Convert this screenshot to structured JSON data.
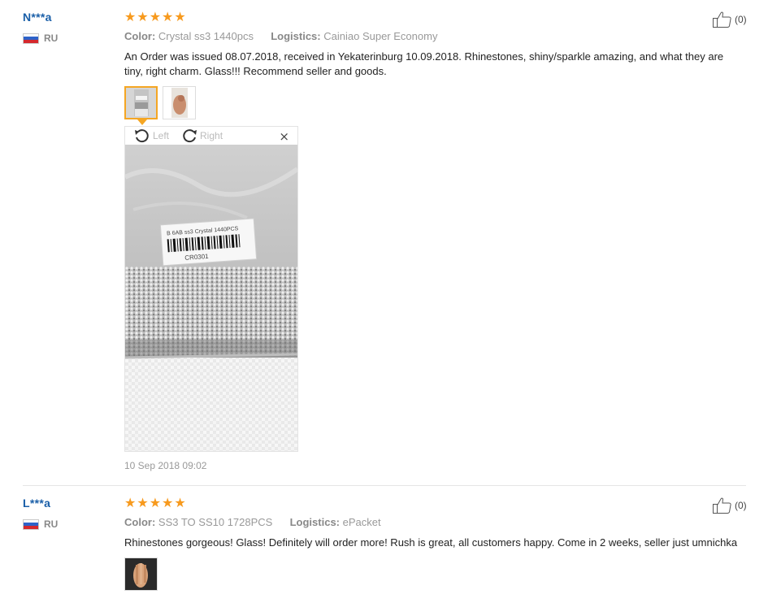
{
  "reviews": [
    {
      "user": "N***a",
      "country": "RU",
      "rating": 5,
      "color_label": "Color:",
      "color_value": "Crystal ss3 1440pcs",
      "logistics_label": "Logistics:",
      "logistics_value": "Cainiao Super Economy",
      "text": "An Order was issued 08.07.2018, received in Yekaterinburg 10.09.2018. Rhinestones, shiny/sparkle amazing, and what they are tiny, right charm. Glass!!! Recommend seller and goods.",
      "helpful": "(0)",
      "viewer": {
        "rotate_left": "Left",
        "rotate_right": "Right",
        "close": "×",
        "label_line1": "B 6AB    ss3 Crystal 1440PCS",
        "label_code": "CR0301"
      },
      "date": "10 Sep 2018 09:02"
    },
    {
      "user": "L***a",
      "country": "RU",
      "rating": 5,
      "color_label": "Color:",
      "color_value": "SS3 TO SS10 1728PCS",
      "logistics_label": "Logistics:",
      "logistics_value": "ePacket",
      "text": "Rhinestones gorgeous! Glass! Definitely will order more! Rush is great, all customers happy. Come in 2 weeks, seller just umnichka",
      "helpful": "(0)"
    }
  ],
  "star_char": "★",
  "colors": {
    "username": "#1a5fa8",
    "star": "#f79a1e",
    "selected_thumb": "#f5a623"
  },
  "icons": {
    "helpful": "thumbs-up-icon",
    "rotate_left": "rotate-left-icon",
    "rotate_right": "rotate-right-icon",
    "close": "close-icon",
    "flag": "russia-flag-icon"
  }
}
